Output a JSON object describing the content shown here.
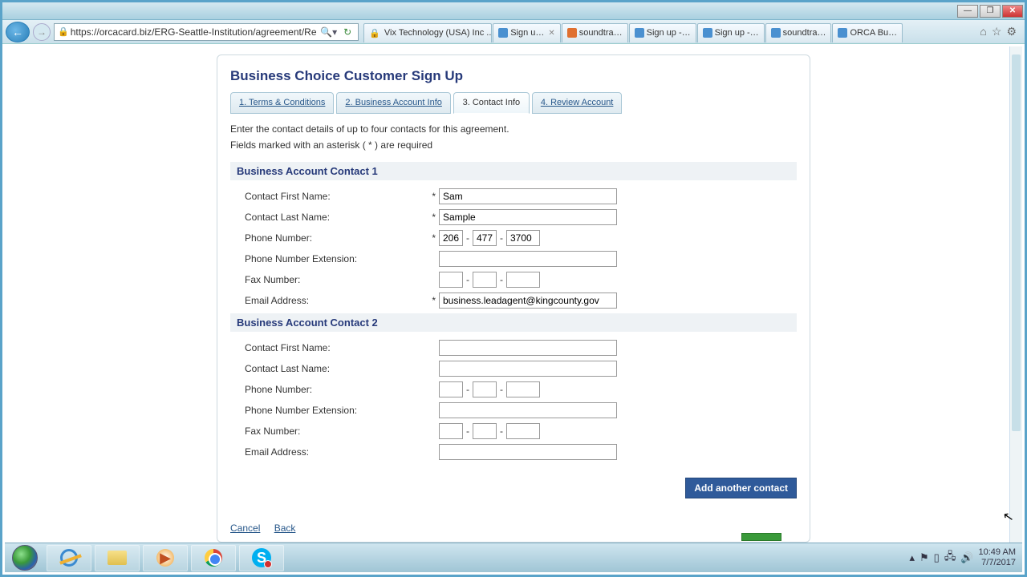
{
  "browser": {
    "url": "https://orcacard.biz/ERG-Seattle-Institution/agreement/Reg",
    "active_tab_title": "Vix Technology (USA) Inc ...",
    "tabs": [
      "Sign u…",
      "soundtra…",
      "Sign up -…",
      "Sign up -…",
      "soundtra…",
      "ORCA Bu…"
    ]
  },
  "page": {
    "title": "Business Choice Customer Sign Up",
    "steps": [
      "1. Terms & Conditions",
      "2. Business Account Info",
      "3. Contact Info",
      "4. Review Account"
    ],
    "intro": "Enter the contact details of up to four contacts for this agreement.",
    "required_note": "Fields marked with an asterisk ( * ) are required",
    "section1": "Business Account Contact 1",
    "section2": "Business Account Contact 2",
    "labels": {
      "first": "Contact First Name:",
      "last": "Contact Last Name:",
      "phone": "Phone Number:",
      "ext": "Phone Number Extension:",
      "fax": "Fax Number:",
      "email": "Email Address:"
    },
    "contact1": {
      "first": "Sam",
      "last": "Sample",
      "phone1": "206",
      "phone2": "477",
      "phone3": "3700",
      "ext": "",
      "fax1": "",
      "fax2": "",
      "fax3": "",
      "email": "business.leadagent@kingcounty.gov"
    },
    "contact2": {
      "first": "",
      "last": "",
      "phone1": "",
      "phone2": "",
      "phone3": "",
      "ext": "",
      "fax1": "",
      "fax2": "",
      "fax3": "",
      "email": ""
    },
    "add_button": "Add another contact",
    "cancel": "Cancel",
    "back": "Back"
  },
  "taskbar": {
    "time": "10:49 AM",
    "date": "7/7/2017"
  }
}
